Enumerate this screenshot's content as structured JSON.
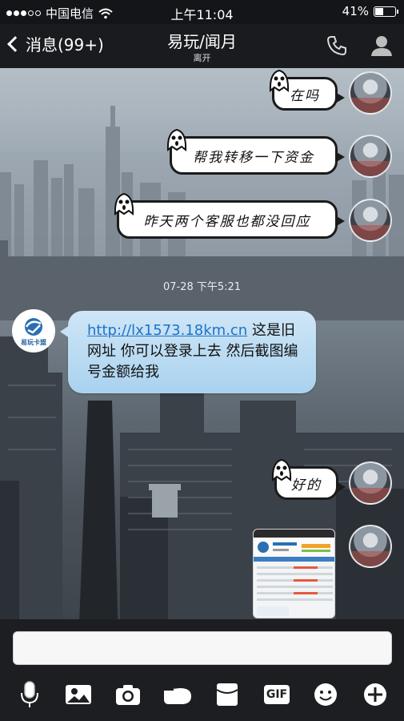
{
  "status_bar": {
    "carrier": "中国电信",
    "time": "上午11:04",
    "battery": "41%"
  },
  "nav": {
    "back_label": "消息(99+)",
    "title": "易玩/闻月",
    "subtitle": "离开"
  },
  "messages": {
    "m1": "在吗",
    "m2": "帮我转移一下资金",
    "m3": "昨天两个客服也都没回应",
    "timestamp": "07-28 下午5:21",
    "m4_link": "http://lx1573.18km.cn",
    "m4_text": " 这是旧网址 你可以登录上去 然后截图编号金额给我",
    "m5": "好的"
  },
  "brand_avatar": {
    "text": "易玩卡盟"
  },
  "input": {
    "placeholder": ""
  },
  "toolbar": {
    "gif_label": "GIF"
  },
  "colors": {
    "bubble_blue": "#a9d2ef",
    "link_blue": "#1c73c9",
    "bar_dark": "#1a1b1f"
  },
  "icons": [
    "back-chevron-icon",
    "phone-icon",
    "person-icon",
    "mic-icon",
    "image-icon",
    "camera-icon",
    "hand-icon",
    "envelope-icon",
    "gif-icon",
    "emoji-icon",
    "plus-icon"
  ]
}
